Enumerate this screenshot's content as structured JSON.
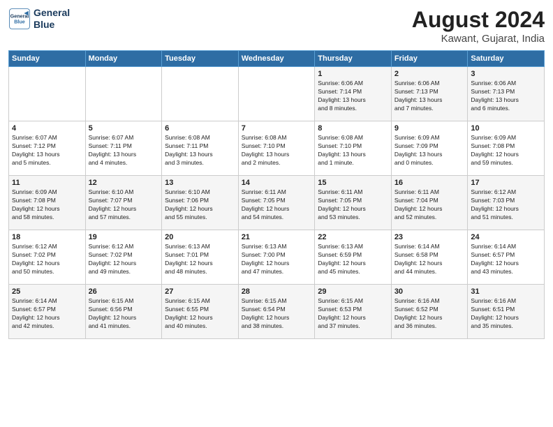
{
  "logo": {
    "line1": "General",
    "line2": "Blue"
  },
  "title": "August 2024",
  "location": "Kawant, Gujarat, India",
  "days_of_week": [
    "Sunday",
    "Monday",
    "Tuesday",
    "Wednesday",
    "Thursday",
    "Friday",
    "Saturday"
  ],
  "weeks": [
    [
      {
        "day": "",
        "info": ""
      },
      {
        "day": "",
        "info": ""
      },
      {
        "day": "",
        "info": ""
      },
      {
        "day": "",
        "info": ""
      },
      {
        "day": "1",
        "info": "Sunrise: 6:06 AM\nSunset: 7:14 PM\nDaylight: 13 hours\nand 8 minutes."
      },
      {
        "day": "2",
        "info": "Sunrise: 6:06 AM\nSunset: 7:13 PM\nDaylight: 13 hours\nand 7 minutes."
      },
      {
        "day": "3",
        "info": "Sunrise: 6:06 AM\nSunset: 7:13 PM\nDaylight: 13 hours\nand 6 minutes."
      }
    ],
    [
      {
        "day": "4",
        "info": "Sunrise: 6:07 AM\nSunset: 7:12 PM\nDaylight: 13 hours\nand 5 minutes."
      },
      {
        "day": "5",
        "info": "Sunrise: 6:07 AM\nSunset: 7:11 PM\nDaylight: 13 hours\nand 4 minutes."
      },
      {
        "day": "6",
        "info": "Sunrise: 6:08 AM\nSunset: 7:11 PM\nDaylight: 13 hours\nand 3 minutes."
      },
      {
        "day": "7",
        "info": "Sunrise: 6:08 AM\nSunset: 7:10 PM\nDaylight: 13 hours\nand 2 minutes."
      },
      {
        "day": "8",
        "info": "Sunrise: 6:08 AM\nSunset: 7:10 PM\nDaylight: 13 hours\nand 1 minute."
      },
      {
        "day": "9",
        "info": "Sunrise: 6:09 AM\nSunset: 7:09 PM\nDaylight: 13 hours\nand 0 minutes."
      },
      {
        "day": "10",
        "info": "Sunrise: 6:09 AM\nSunset: 7:08 PM\nDaylight: 12 hours\nand 59 minutes."
      }
    ],
    [
      {
        "day": "11",
        "info": "Sunrise: 6:09 AM\nSunset: 7:08 PM\nDaylight: 12 hours\nand 58 minutes."
      },
      {
        "day": "12",
        "info": "Sunrise: 6:10 AM\nSunset: 7:07 PM\nDaylight: 12 hours\nand 57 minutes."
      },
      {
        "day": "13",
        "info": "Sunrise: 6:10 AM\nSunset: 7:06 PM\nDaylight: 12 hours\nand 55 minutes."
      },
      {
        "day": "14",
        "info": "Sunrise: 6:11 AM\nSunset: 7:05 PM\nDaylight: 12 hours\nand 54 minutes."
      },
      {
        "day": "15",
        "info": "Sunrise: 6:11 AM\nSunset: 7:05 PM\nDaylight: 12 hours\nand 53 minutes."
      },
      {
        "day": "16",
        "info": "Sunrise: 6:11 AM\nSunset: 7:04 PM\nDaylight: 12 hours\nand 52 minutes."
      },
      {
        "day": "17",
        "info": "Sunrise: 6:12 AM\nSunset: 7:03 PM\nDaylight: 12 hours\nand 51 minutes."
      }
    ],
    [
      {
        "day": "18",
        "info": "Sunrise: 6:12 AM\nSunset: 7:02 PM\nDaylight: 12 hours\nand 50 minutes."
      },
      {
        "day": "19",
        "info": "Sunrise: 6:12 AM\nSunset: 7:02 PM\nDaylight: 12 hours\nand 49 minutes."
      },
      {
        "day": "20",
        "info": "Sunrise: 6:13 AM\nSunset: 7:01 PM\nDaylight: 12 hours\nand 48 minutes."
      },
      {
        "day": "21",
        "info": "Sunrise: 6:13 AM\nSunset: 7:00 PM\nDaylight: 12 hours\nand 47 minutes."
      },
      {
        "day": "22",
        "info": "Sunrise: 6:13 AM\nSunset: 6:59 PM\nDaylight: 12 hours\nand 45 minutes."
      },
      {
        "day": "23",
        "info": "Sunrise: 6:14 AM\nSunset: 6:58 PM\nDaylight: 12 hours\nand 44 minutes."
      },
      {
        "day": "24",
        "info": "Sunrise: 6:14 AM\nSunset: 6:57 PM\nDaylight: 12 hours\nand 43 minutes."
      }
    ],
    [
      {
        "day": "25",
        "info": "Sunrise: 6:14 AM\nSunset: 6:57 PM\nDaylight: 12 hours\nand 42 minutes."
      },
      {
        "day": "26",
        "info": "Sunrise: 6:15 AM\nSunset: 6:56 PM\nDaylight: 12 hours\nand 41 minutes."
      },
      {
        "day": "27",
        "info": "Sunrise: 6:15 AM\nSunset: 6:55 PM\nDaylight: 12 hours\nand 40 minutes."
      },
      {
        "day": "28",
        "info": "Sunrise: 6:15 AM\nSunset: 6:54 PM\nDaylight: 12 hours\nand 38 minutes."
      },
      {
        "day": "29",
        "info": "Sunrise: 6:15 AM\nSunset: 6:53 PM\nDaylight: 12 hours\nand 37 minutes."
      },
      {
        "day": "30",
        "info": "Sunrise: 6:16 AM\nSunset: 6:52 PM\nDaylight: 12 hours\nand 36 minutes."
      },
      {
        "day": "31",
        "info": "Sunrise: 6:16 AM\nSunset: 6:51 PM\nDaylight: 12 hours\nand 35 minutes."
      }
    ]
  ]
}
